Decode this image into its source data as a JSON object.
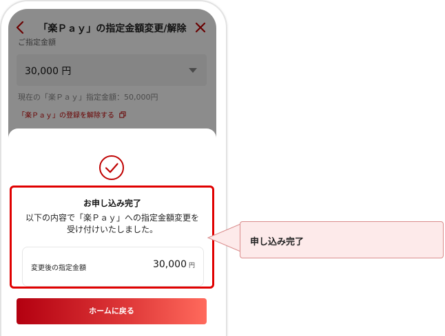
{
  "header": {
    "title": "「楽Ｐａｙ」の指定金額変更/解除"
  },
  "form": {
    "section_label": "ご指定金額",
    "selected_amount": "30,000 円",
    "current_amount": "現在の「楽Ｐａｙ」指定金額：50,000円",
    "unregister_link": "「楽Ｐａｙ」の登録を解除する"
  },
  "sheet": {
    "title": "お申し込み完了",
    "message_line1": "以下の内容で「楽Ｐａｙ」への指定金額変更を",
    "message_line2": "受け付けいたしました。",
    "detail_label": "変更後の指定金額",
    "detail_value": "30,000",
    "detail_unit": "円",
    "home_button": "ホームに戻る"
  },
  "annotation": {
    "callout_text": "申し込み完了"
  },
  "colors": {
    "brand_red": "#bf0000",
    "highlight_red": "#e00000",
    "callout_bg": "#fdeaea"
  }
}
